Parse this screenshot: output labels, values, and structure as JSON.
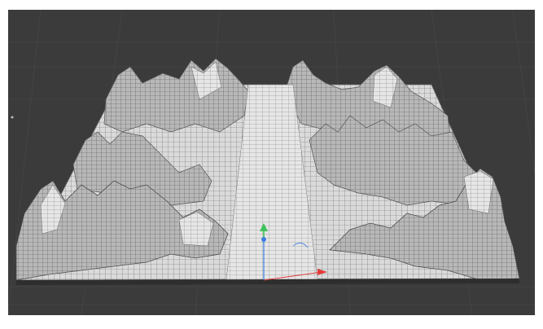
{
  "viewport": {
    "background": "#3b3b3b",
    "grid_color": "#4a4a4a",
    "terrain_fill": "#d9d9d9",
    "terrain_shadow": "#9a9a9a",
    "wire_color": "#555555"
  },
  "gizmo": {
    "x_axis_color": "#e23b3b",
    "y_axis_color": "#3cc25a",
    "z_axis_color": "#3b7ee2",
    "x_icon": "x-axis-arrow-icon",
    "y_icon": "y-axis-arrow-icon",
    "z_icon": "z-axis-arrow-icon"
  }
}
